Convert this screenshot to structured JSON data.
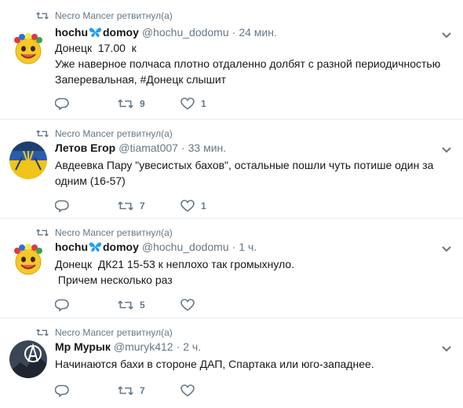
{
  "retweeted_by": "Necro Mancer ретвитнул(а)",
  "tweets": [
    {
      "name_part1": "hochu",
      "name_part2": "domoy",
      "handle": "@hochu_dodomu",
      "time": "24 мин.",
      "lines": [
        "Донецк  17.00  к",
        "Уже наверное полчаса плотно отдаленно долбят с разной периодичностью",
        "Заперевальная, #Донецк слышит"
      ],
      "retweets": "9",
      "likes": "1",
      "avatar": "emoji-avatar"
    },
    {
      "name": "Летов Егор",
      "handle": "@tiamat007",
      "time": "33 мин.",
      "lines": [
        "Авдеевка Пару \"увесистых бахов\", остальные пошли чуть потише один за",
        "одним (16-57)"
      ],
      "retweets": "7",
      "likes": "1",
      "avatar": "flag-avatar"
    },
    {
      "name_part1": "hochu",
      "name_part2": "domoy",
      "handle": "@hochu_dodomu",
      "time": "1 ч.",
      "lines": [
        "Донецк  ДК21 15-53 к неплохо так громыхнуло.",
        " Причем несколько раз"
      ],
      "retweets": "5",
      "likes": "",
      "avatar": "emoji-avatar"
    },
    {
      "name": "Мр Мурык",
      "handle": "@muryk412",
      "time": "2 ч.",
      "lines": [
        "Начинаются бахи в стороне ДАП, Спартака или юго-западнее."
      ],
      "retweets": "7",
      "likes": "",
      "avatar": "anarchy-avatar"
    }
  ],
  "separator_dot": "·",
  "colors": {
    "text": "#14171a",
    "secondary": "#657786",
    "border": "#e6ecf0",
    "butterfly": "#1da1f2"
  }
}
